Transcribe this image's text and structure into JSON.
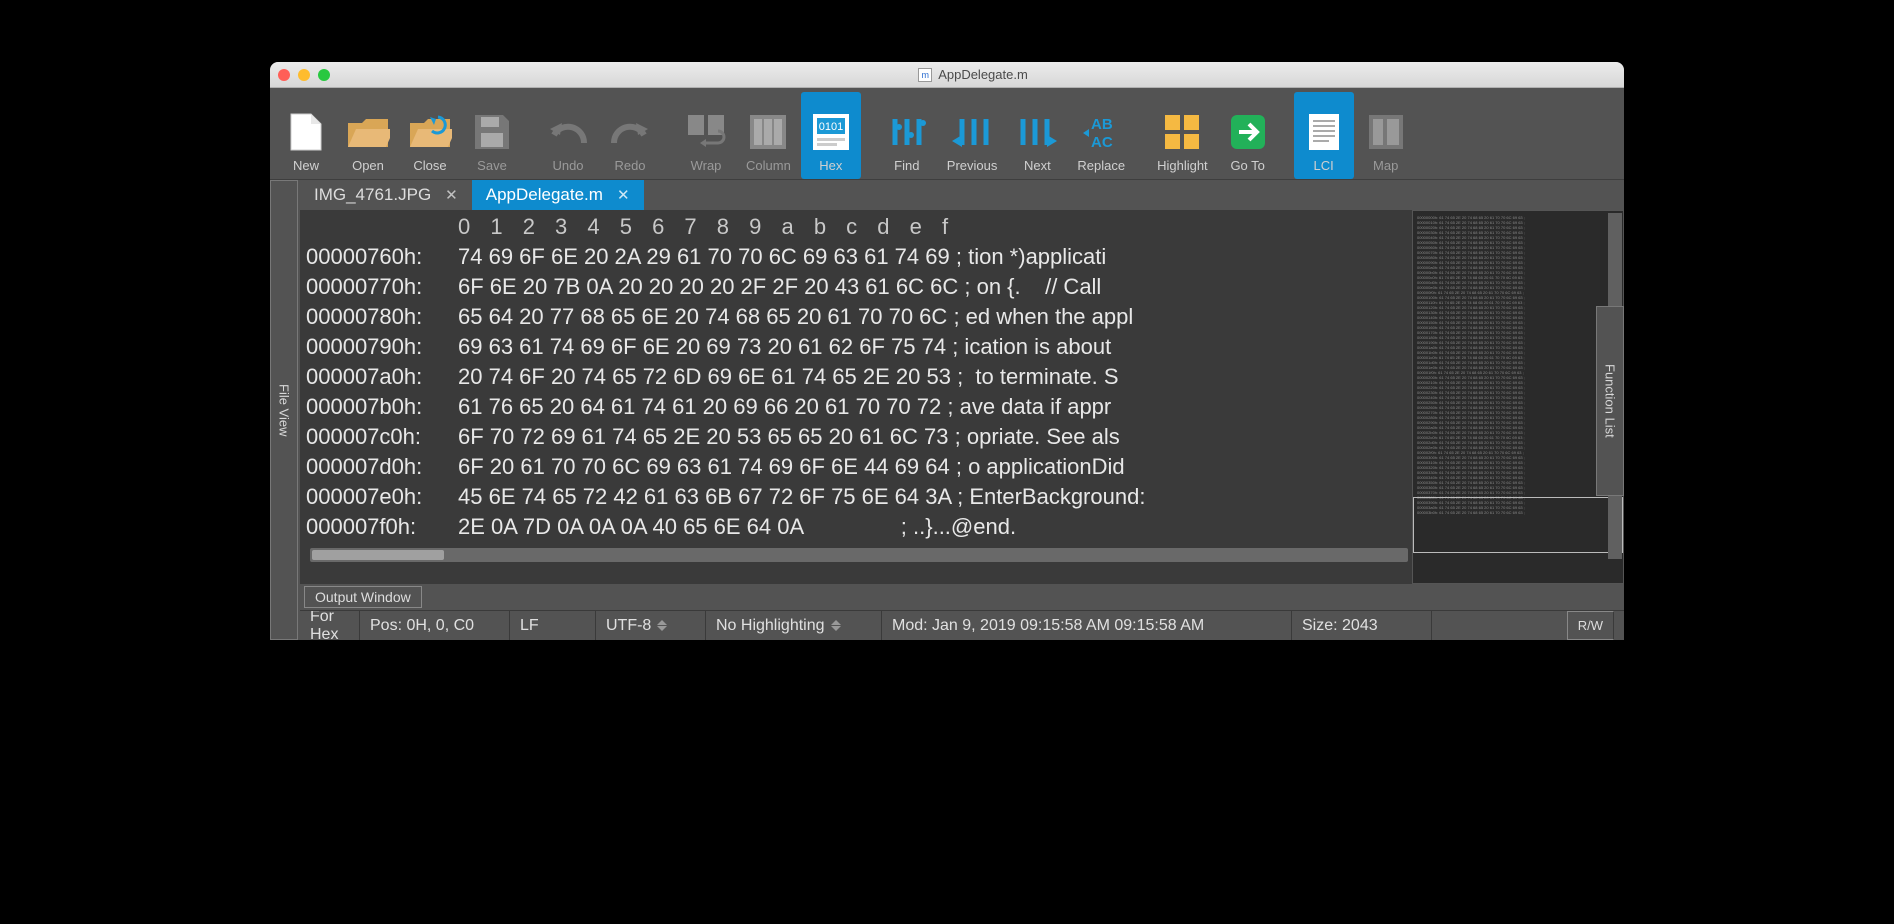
{
  "window": {
    "title": "AppDelegate.m"
  },
  "toolbar": [
    {
      "id": "new",
      "label": "New",
      "active": false
    },
    {
      "id": "open",
      "label": "Open",
      "active": false
    },
    {
      "id": "close",
      "label": "Close",
      "active": false
    },
    {
      "id": "save",
      "label": "Save",
      "active": false,
      "disabled": true
    },
    {
      "id": "undo",
      "label": "Undo",
      "active": false,
      "disabled": true
    },
    {
      "id": "redo",
      "label": "Redo",
      "active": false,
      "disabled": true
    },
    {
      "id": "wrap",
      "label": "Wrap",
      "active": false,
      "disabled": true
    },
    {
      "id": "column",
      "label": "Column",
      "active": false,
      "disabled": true
    },
    {
      "id": "hex",
      "label": "Hex",
      "active": true
    },
    {
      "id": "find",
      "label": "Find",
      "active": false
    },
    {
      "id": "previous",
      "label": "Previous",
      "active": false
    },
    {
      "id": "next",
      "label": "Next",
      "active": false
    },
    {
      "id": "replace",
      "label": "Replace",
      "active": false
    },
    {
      "id": "highlight",
      "label": "Highlight",
      "active": false
    },
    {
      "id": "goto",
      "label": "Go To",
      "active": false
    },
    {
      "id": "lci",
      "label": "LCI",
      "active": true
    },
    {
      "id": "map",
      "label": "Map",
      "active": false,
      "disabled": true
    }
  ],
  "side_left_label": "File View",
  "side_right_label": "Function List",
  "tabs": [
    {
      "label": "IMG_4761.JPG",
      "active": false
    },
    {
      "label": "AppDelegate.m",
      "active": true
    }
  ],
  "hex": {
    "col_header": [
      "0",
      "1",
      "2",
      "3",
      "4",
      "5",
      "6",
      "7",
      "8",
      "9",
      "a",
      "b",
      "c",
      "d",
      "e",
      "f"
    ],
    "rows": [
      {
        "addr": "00000760h:",
        "bytes": "74 69 6F 6E 20 2A 29 61 70 70 6C 69 63 61 74 69",
        "ascii": "tion *)applicati"
      },
      {
        "addr": "00000770h:",
        "bytes": "6F 6E 20 7B 0A 20 20 20 20 2F 2F 20 43 61 6C 6C",
        "ascii": "on {.    // Call"
      },
      {
        "addr": "00000780h:",
        "bytes": "65 64 20 77 68 65 6E 20 74 68 65 20 61 70 70 6C",
        "ascii": "ed when the appl"
      },
      {
        "addr": "00000790h:",
        "bytes": "69 63 61 74 69 6F 6E 20 69 73 20 61 62 6F 75 74",
        "ascii": "ication is about"
      },
      {
        "addr": "000007a0h:",
        "bytes": "20 74 6F 20 74 65 72 6D 69 6E 61 74 65 2E 20 53",
        "ascii": " to terminate. S"
      },
      {
        "addr": "000007b0h:",
        "bytes": "61 76 65 20 64 61 74 61 20 69 66 20 61 70 70 72",
        "ascii": "ave data if appr"
      },
      {
        "addr": "000007c0h:",
        "bytes": "6F 70 72 69 61 74 65 2E 20 53 65 65 20 61 6C 73",
        "ascii": "opriate. See als"
      },
      {
        "addr": "000007d0h:",
        "bytes": "6F 20 61 70 70 6C 69 63 61 74 69 6F 6E 44 69 64",
        "ascii": "o applicationDid"
      },
      {
        "addr": "000007e0h:",
        "bytes": "45 6E 74 65 72 42 61 63 6B 67 72 6F 75 6E 64 3A",
        "ascii": "EnterBackground:"
      },
      {
        "addr": "000007f0h:",
        "bytes": "2E 0A 7D 0A 0A 0A 40 65 6E 64 0A               ",
        "ascii": "..}...@end."
      }
    ]
  },
  "output_window_label": "Output Window",
  "status": {
    "mode": "For Hex",
    "pos": "Pos: 0H, 0, C0",
    "line_ending": "LF",
    "encoding": "UTF-8",
    "highlighting": "No Highlighting",
    "mod": "Mod: Jan 9, 2019 09:15:58 AM 09:15:58 AM",
    "size": "Size: 2043",
    "rw": "R/W"
  },
  "toolbar_groups": [
    [
      "new",
      "open",
      "close",
      "save"
    ],
    [
      "undo",
      "redo"
    ],
    [
      "wrap",
      "column",
      "hex"
    ],
    [
      "find",
      "previous",
      "next",
      "replace"
    ],
    [
      "highlight",
      "goto"
    ],
    [
      "lci",
      "map"
    ]
  ]
}
